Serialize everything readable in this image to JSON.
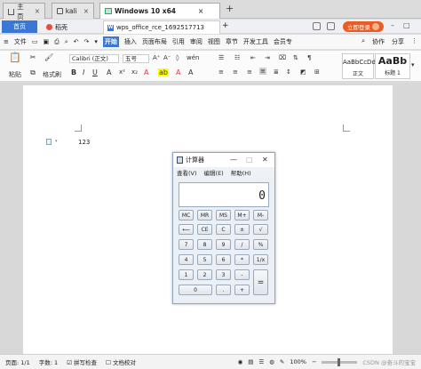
{
  "vm_tabs": [
    {
      "label": "主页",
      "icon": "home-icon"
    },
    {
      "label": "kali",
      "icon": "vm-icon"
    },
    {
      "label": "Windows 10 x64",
      "icon": "windows-vm-icon"
    }
  ],
  "wps": {
    "home_tab": "首页",
    "daoke_tab": "稻壳",
    "doc_tab": "wps_office_rce_1692517713",
    "login": "立即登录"
  },
  "menu": {
    "file": "文件",
    "start": "开始",
    "items": [
      "插入",
      "页面布局",
      "引用",
      "审阅",
      "视图",
      "章节",
      "开发工具",
      "会员专"
    ],
    "share": "分享",
    "collab": "协作"
  },
  "ribbon": {
    "paste": "粘贴",
    "format_painter": "格式刷",
    "font": "Calibri (正文)",
    "size": "五号",
    "style_normal_preview": "AaBbCcDd",
    "style_normal": "正文",
    "style_h1_preview": "AaBb",
    "style_h1": "标题 1"
  },
  "document": {
    "text": "123"
  },
  "calculator": {
    "title": "计算器",
    "menu": [
      "查看(V)",
      "编辑(E)",
      "帮助(H)"
    ],
    "display": "0",
    "keys": [
      [
        "MC",
        "MR",
        "MS",
        "M+",
        "M-"
      ],
      [
        "⟵",
        "CE",
        "C",
        "±",
        "√"
      ],
      [
        "7",
        "8",
        "9",
        "/",
        "%"
      ],
      [
        "4",
        "5",
        "6",
        "*",
        "1/x"
      ],
      [
        "1",
        "2",
        "3",
        "-",
        ""
      ],
      [
        "0",
        ".",
        "+",
        "="
      ]
    ]
  },
  "status": {
    "page": "页面: 1/1",
    "words": "字数: 1",
    "spell": "拼写检查",
    "proof": "文档校对",
    "zoom": "100%",
    "watermark": "CSDN @奋斗的宝宝"
  }
}
